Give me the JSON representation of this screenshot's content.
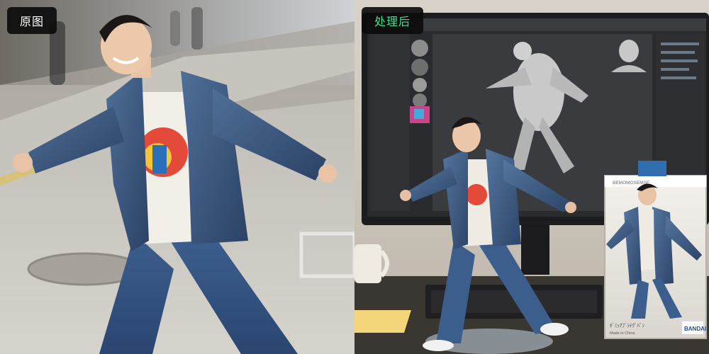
{
  "labels": {
    "original": "原图",
    "processed": "处理后"
  },
  "figure_box": {
    "brand": "BANDAI",
    "header": "BEMOMOSEMSE",
    "caption_line1": "ｷﾞﾐｯｱﾌﾞｼﾃｸﾞﾊﾞﾝ",
    "caption_line2": "Made in China"
  },
  "colors": {
    "processed_accent": "#39e58c",
    "original_label": "#ffffff",
    "label_bg": "#0c0c0c"
  }
}
